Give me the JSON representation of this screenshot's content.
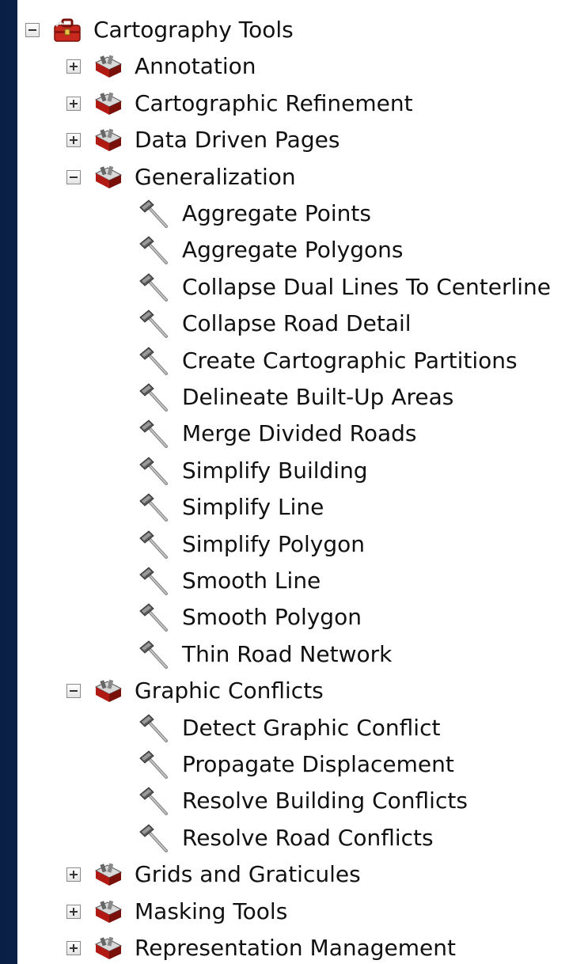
{
  "root": {
    "label": "Cartography Tools",
    "expanded": true,
    "icon": "red-toolbox-icon"
  },
  "toolsets": [
    {
      "label": "Annotation",
      "expanded": false,
      "icon": "toolset-icon",
      "tools": []
    },
    {
      "label": "Cartographic Refinement",
      "expanded": false,
      "icon": "toolset-icon",
      "tools": []
    },
    {
      "label": "Data Driven Pages",
      "expanded": false,
      "icon": "toolset-icon",
      "tools": []
    },
    {
      "label": "Generalization",
      "expanded": true,
      "icon": "toolset-icon",
      "tools": [
        {
          "label": "Aggregate Points",
          "icon": "hammer-icon"
        },
        {
          "label": "Aggregate Polygons",
          "icon": "hammer-icon"
        },
        {
          "label": "Collapse Dual Lines To Centerline",
          "icon": "hammer-icon"
        },
        {
          "label": "Collapse Road Detail",
          "icon": "hammer-icon"
        },
        {
          "label": "Create Cartographic Partitions",
          "icon": "hammer-icon"
        },
        {
          "label": "Delineate Built-Up Areas",
          "icon": "hammer-icon"
        },
        {
          "label": "Merge Divided Roads",
          "icon": "hammer-icon"
        },
        {
          "label": "Simplify Building",
          "icon": "hammer-icon"
        },
        {
          "label": "Simplify Line",
          "icon": "hammer-icon"
        },
        {
          "label": "Simplify Polygon",
          "icon": "hammer-icon"
        },
        {
          "label": "Smooth Line",
          "icon": "hammer-icon"
        },
        {
          "label": "Smooth Polygon",
          "icon": "hammer-icon"
        },
        {
          "label": "Thin Road Network",
          "icon": "hammer-icon"
        }
      ]
    },
    {
      "label": "Graphic Conflicts",
      "expanded": true,
      "icon": "toolset-icon",
      "tools": [
        {
          "label": "Detect Graphic Conflict",
          "icon": "hammer-icon"
        },
        {
          "label": "Propagate Displacement",
          "icon": "hammer-icon"
        },
        {
          "label": "Resolve Building Conflicts",
          "icon": "hammer-icon"
        },
        {
          "label": "Resolve Road Conflicts",
          "icon": "hammer-icon"
        }
      ]
    },
    {
      "label": "Grids and Graticules",
      "expanded": false,
      "icon": "toolset-icon",
      "tools": []
    },
    {
      "label": "Masking Tools",
      "expanded": false,
      "icon": "toolset-icon",
      "tools": []
    },
    {
      "label": "Representation Management",
      "expanded": false,
      "icon": "toolset-icon",
      "tools": []
    }
  ],
  "colors": {
    "background_dark": "#0a1f44",
    "background_light": "#1a9be0",
    "panel": "#ffffff",
    "toolbox_red": "#c8281e"
  }
}
